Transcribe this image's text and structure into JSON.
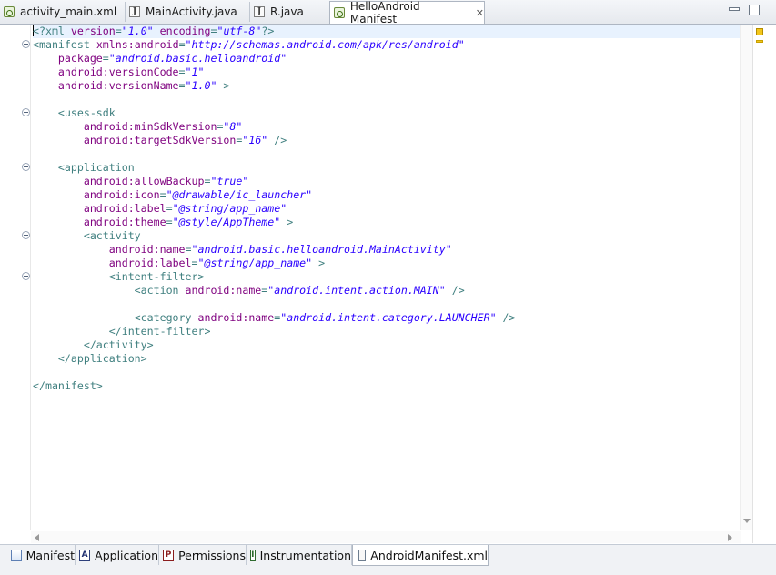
{
  "tabs": [
    {
      "label": "activity_main.xml",
      "icon": "xml-file-icon",
      "active": false
    },
    {
      "label": "MainActivity.java",
      "icon": "java-file-icon",
      "active": false
    },
    {
      "label": "R.java",
      "icon": "java-file-icon",
      "active": false
    },
    {
      "label": "HelloAndroid Manifest",
      "icon": "android-file-icon",
      "active": true
    }
  ],
  "code_lines": [
    "<?xml version=\"1.0\" encoding=\"utf-8\"?>",
    "<manifest xmlns:android=\"http://schemas.android.com/apk/res/android\"",
    "    package=\"android.basic.helloandroid\"",
    "    android:versionCode=\"1\"",
    "    android:versionName=\"1.0\" >",
    "",
    "    <uses-sdk",
    "        android:minSdkVersion=\"8\"",
    "        android:targetSdkVersion=\"16\" />",
    "",
    "    <application",
    "        android:allowBackup=\"true\"",
    "        android:icon=\"@drawable/ic_launcher\"",
    "        android:label=\"@string/app_name\"",
    "        android:theme=\"@style/AppTheme\" >",
    "        <activity",
    "            android:name=\"android.basic.helloandroid.MainActivity\"",
    "            android:label=\"@string/app_name\" >",
    "            <intent-filter>",
    "                <action android:name=\"android.intent.action.MAIN\" />",
    "",
    "                <category android:name=\"android.intent.category.LAUNCHER\" />",
    "            </intent-filter>",
    "        </activity>",
    "    </application>",
    "",
    "</manifest>"
  ],
  "bottom_tabs": [
    {
      "label": "Manifest",
      "icon": "manifest-icon",
      "active": false
    },
    {
      "label": "Application",
      "icon": "application-icon",
      "active": false
    },
    {
      "label": "Permissions",
      "icon": "permissions-icon",
      "active": false
    },
    {
      "label": "Instrumentation",
      "icon": "instrumentation-icon",
      "active": false
    },
    {
      "label": "AndroidManifest.xml",
      "icon": "xml-source-icon",
      "active": true
    }
  ],
  "icon_letters": {
    "application": "A",
    "permissions": "P",
    "instrumentation": "I"
  },
  "colors": {
    "tag": "#3f7f7f",
    "attribute": "#7f007f",
    "value": "#2a00ff",
    "current_line": "#e8f2fe"
  }
}
